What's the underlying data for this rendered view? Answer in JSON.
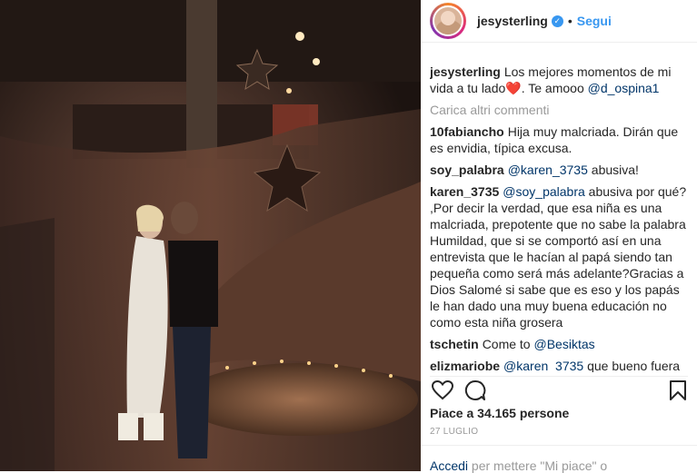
{
  "post": {
    "username": "jesysterling",
    "follow_label": "Segui",
    "dot": "•",
    "verified_mark": "✓"
  },
  "caption": {
    "username": "jesysterling",
    "text_before": "Los mejores momentos de mi vida a tu lado",
    "heart": "❤️",
    "text_after": ". Te amooo ",
    "mention": "@d_ospina1"
  },
  "load_more": "Carica altri commenti",
  "comments": [
    {
      "username": "10fabiancho",
      "text": "Hija muy malcriada. Dirán que es envidia, típica excusa."
    },
    {
      "username": "soy_palabra",
      "mention": "@karen_3735",
      "text": " abusiva!"
    },
    {
      "username": "karen_3735",
      "mention": "@soy_palabra",
      "text": " abusiva por qué? ,Por decir la verdad, que esa niña es una malcriada, prepotente que no sabe la palabra Humildad, que si se comportó así en una entrevista que le hacían al papá siendo tan pequeña como será más adelante?Gracias a Dios Salomé si sabe que es eso y los papás le han dado una muy buena educación no como esta niña grosera"
    },
    {
      "username": "tschetin",
      "text": "Come to ",
      "mention": "@Besiktas"
    },
    {
      "username": "elizmariobe",
      "mention": "@karen_3735",
      "text": " que bueno fuera"
    }
  ],
  "likes": "Piace a 34.165 persone",
  "date": "27 LUGLIO",
  "add_comment": {
    "link": "Accedi",
    "text": " per mettere \"Mi piace\" o"
  },
  "icons": {
    "like": "heart-icon",
    "comment": "comment-icon",
    "save": "bookmark-icon"
  }
}
